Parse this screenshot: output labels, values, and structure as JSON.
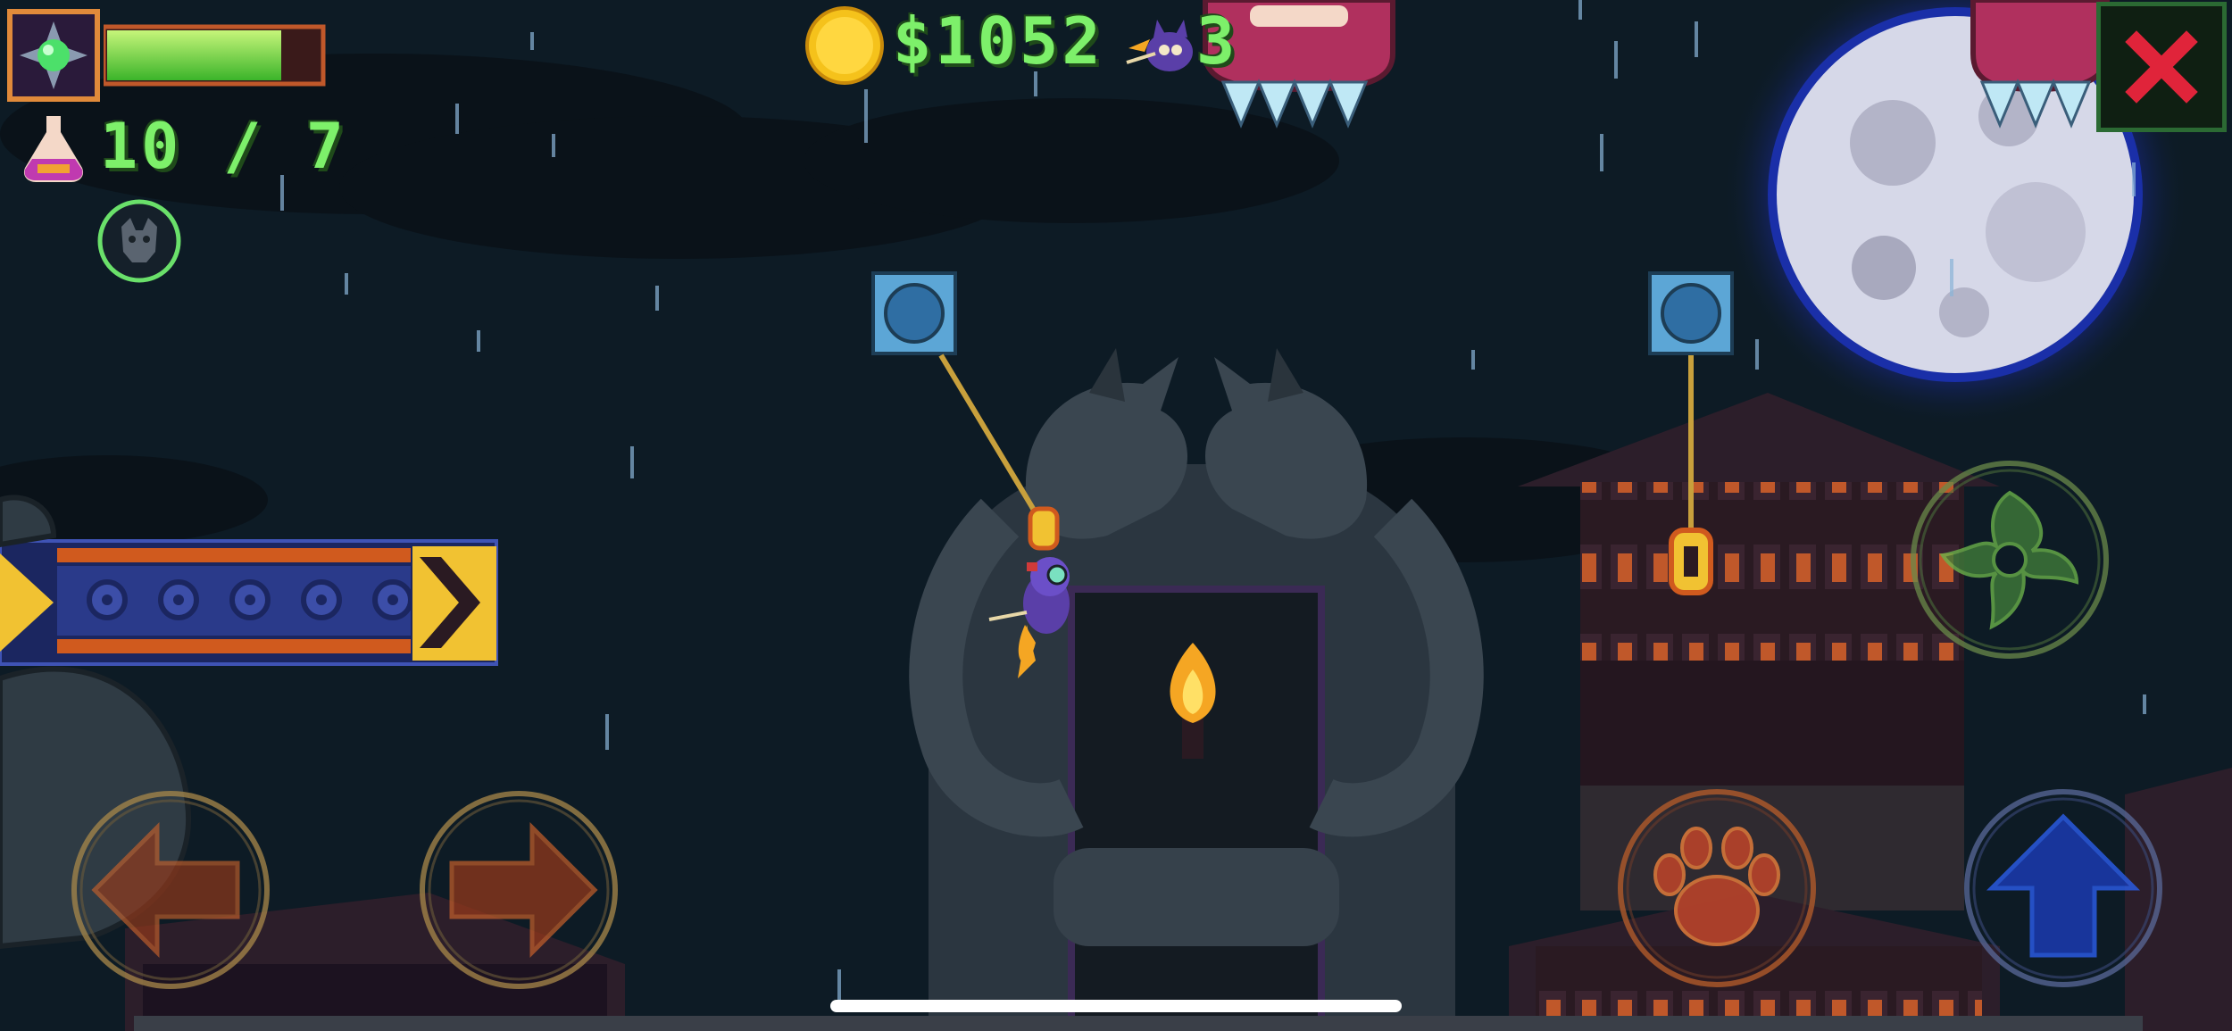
{
  "hud": {
    "health_fraction": 0.82,
    "potions": "10 / 7",
    "money": "$1052",
    "lives": "3",
    "close_icon": "close-x-icon"
  },
  "controls": {
    "move_left_icon": "arrow-left-icon",
    "move_right_icon": "arrow-right-icon",
    "throw_icon": "shuriken-icon",
    "attack_icon": "paw-icon",
    "jump_icon": "arrow-up-icon"
  },
  "colors": {
    "sky": "#0d1b25",
    "hud_green": "#7df06a",
    "health_fill": "#7be24a",
    "coin": "#f5c21b",
    "close_red": "#e0243a",
    "moon": "#d6d8e8",
    "moon_glow": "#1a2fa8"
  }
}
